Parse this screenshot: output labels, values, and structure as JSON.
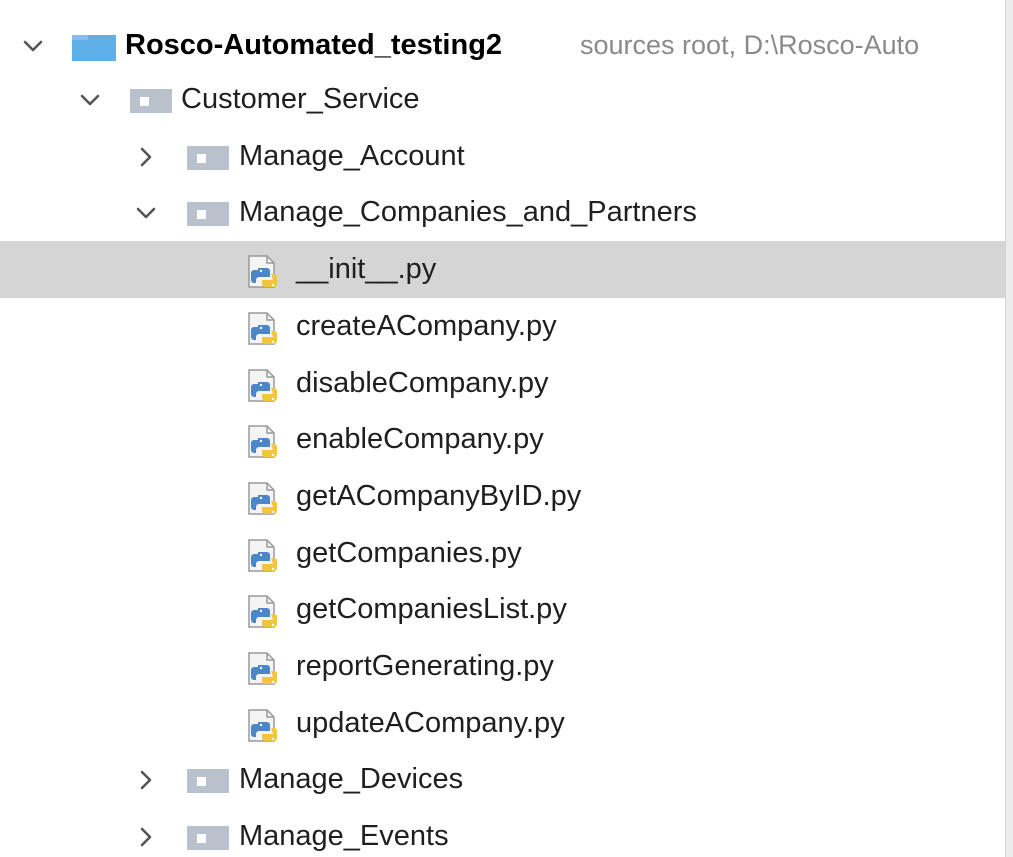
{
  "root": {
    "name": "Rosco-Automated_testing2",
    "meta": "sources root,  D:\\Rosco-Auto"
  },
  "tree": {
    "customer_service": "Customer_Service",
    "manage_account": "Manage_Account",
    "manage_companies": "Manage_Companies_and_Partners",
    "files": [
      "__init__.py",
      "createACompany.py",
      "disableCompany.py",
      "enableCompany.py",
      "getACompanyByID.py",
      "getCompanies.py",
      "getCompaniesList.py",
      "reportGenerating.py",
      "updateACompany.py"
    ],
    "manage_devices": "Manage_Devices",
    "manage_events": "Manage_Events"
  },
  "icons": {
    "expanded": "chevron-down-icon",
    "collapsed": "chevron-right-icon",
    "folder": "folder-icon",
    "python_file": "python-file-icon"
  },
  "colors": {
    "root_folder": "#5fb0e8",
    "package_folder": "#b9c2cc",
    "selection": "#d5d5d5",
    "meta_text": "#8a8a8a",
    "python_blue": "#4b86c9",
    "python_yellow": "#f2c53d"
  }
}
